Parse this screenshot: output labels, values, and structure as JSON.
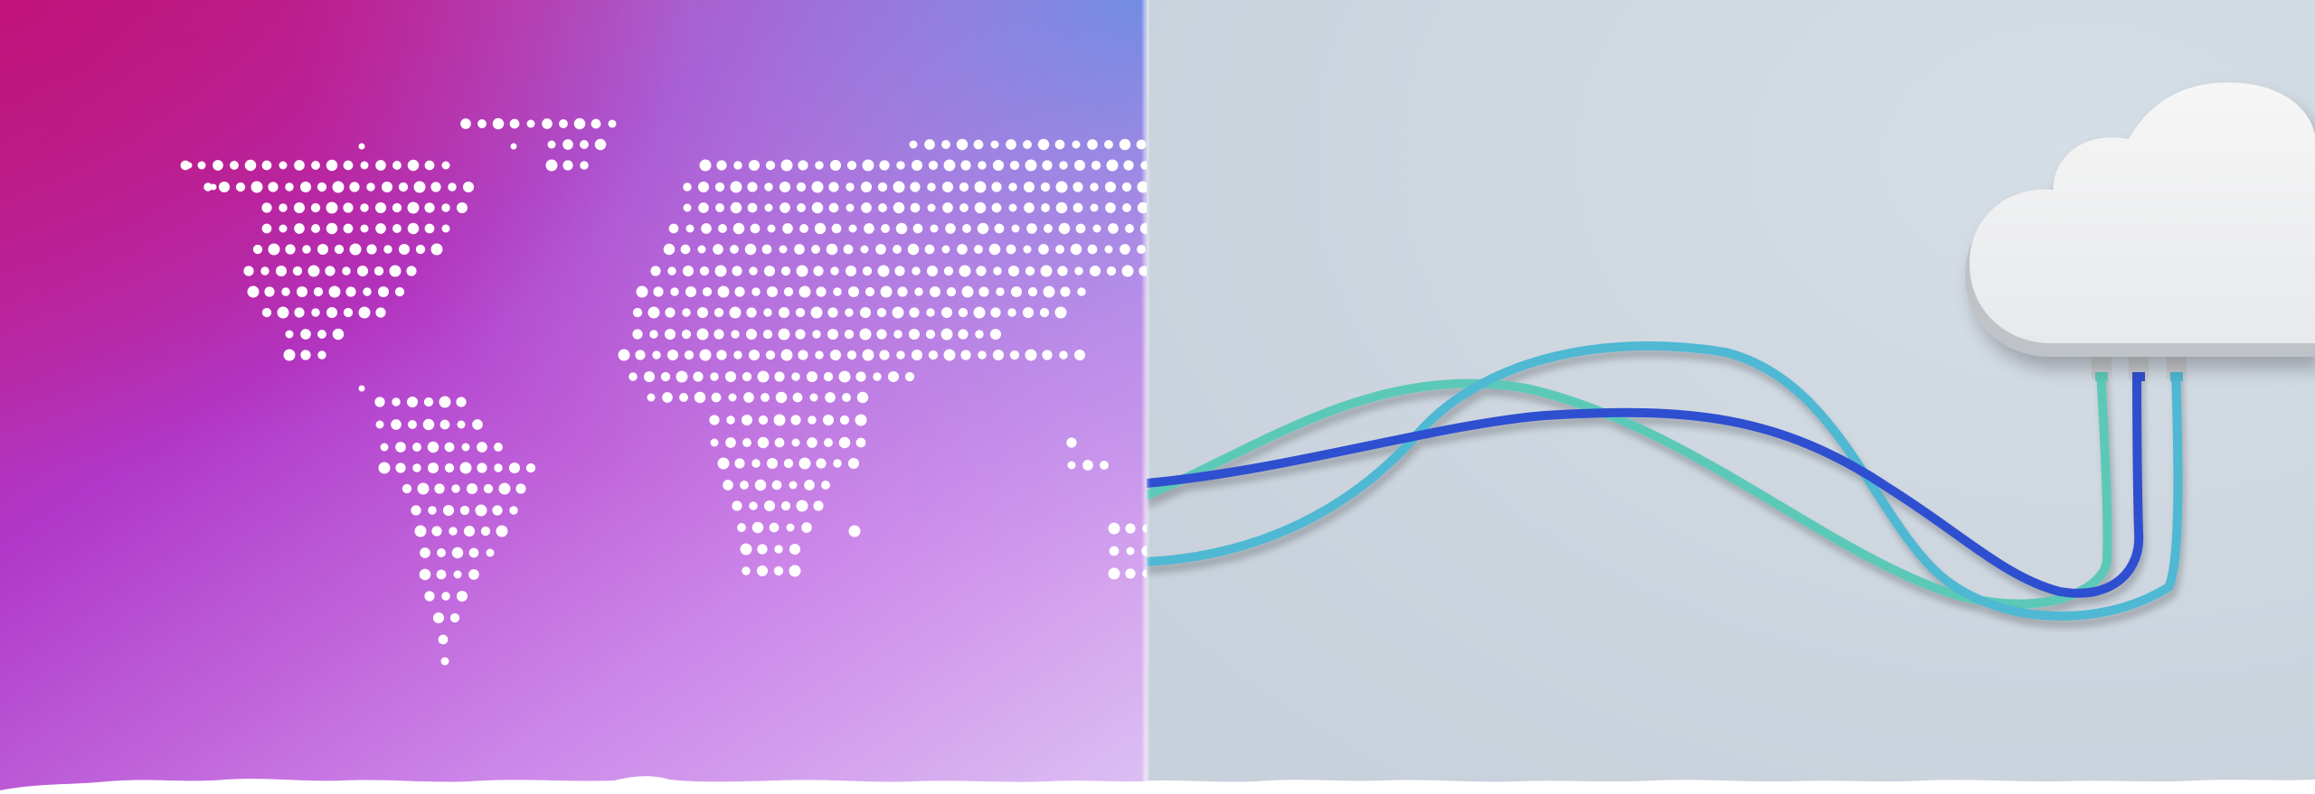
{
  "panels": {
    "left": {
      "illustration": "dotted-world-map",
      "gradient": {
        "colors": [
          "#c0167e",
          "#a928c2",
          "#c471e4",
          "#d7b3f1",
          "#7b89e3"
        ]
      },
      "dot_color": "#ffffff"
    },
    "right": {
      "illustration": "cloud-with-network-cables",
      "background": "#d0d8e1",
      "cloud_color": "#f4f5f6",
      "cable_colors": [
        "#2e4fd0",
        "#5fcdbf",
        "#52c0d6"
      ]
    }
  },
  "edge": {
    "style": "torn-paper",
    "color": "#ffffff"
  }
}
